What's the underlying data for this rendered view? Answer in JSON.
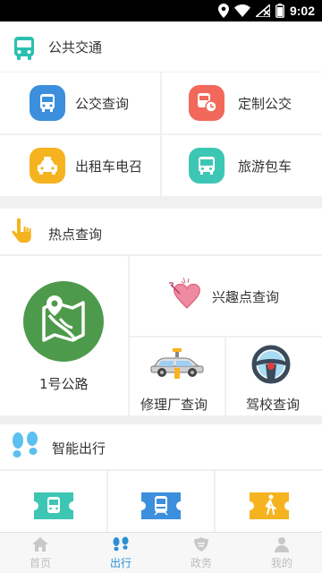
{
  "status_bar": {
    "time": "9:02"
  },
  "transit": {
    "title": "公共交通",
    "items": [
      {
        "label": "公交查询",
        "icon": "bus-icon",
        "color": "#3b8fdc"
      },
      {
        "label": "定制公交",
        "icon": "custom-bus-icon",
        "color": "#f2685a"
      },
      {
        "label": "出租车电召",
        "icon": "taxi-icon",
        "color": "#f6b320"
      },
      {
        "label": "旅游包车",
        "icon": "tour-bus-icon",
        "color": "#3ec6b5"
      }
    ]
  },
  "hotspot": {
    "title": "热点查询",
    "items": [
      {
        "label": "1号公路",
        "icon": "map-icon",
        "color": "#4e9a4c"
      },
      {
        "label": "兴趣点查询",
        "icon": "heart-icon",
        "color": "#e75a7c"
      },
      {
        "label": "修理厂查询",
        "icon": "car-repair-icon"
      },
      {
        "label": "驾校查询",
        "icon": "steering-wheel-icon"
      }
    ]
  },
  "smart": {
    "title": "智能出行",
    "items": [
      {
        "icon": "bus-ticket-icon",
        "color": "#3ec6b5"
      },
      {
        "icon": "train-ticket-icon",
        "color": "#3b8fdc"
      },
      {
        "icon": "walk-ticket-icon",
        "color": "#f6b320"
      }
    ]
  },
  "tabbar": {
    "tabs": [
      {
        "label": "首页",
        "icon": "home-icon",
        "active": false
      },
      {
        "label": "出行",
        "icon": "footprints-icon",
        "active": true
      },
      {
        "label": "政务",
        "icon": "government-icon",
        "active": false
      },
      {
        "label": "我的",
        "icon": "user-icon",
        "active": false
      }
    ]
  },
  "colors": {
    "accent": "#2a8fd6",
    "teal": "#2bbfb0"
  }
}
